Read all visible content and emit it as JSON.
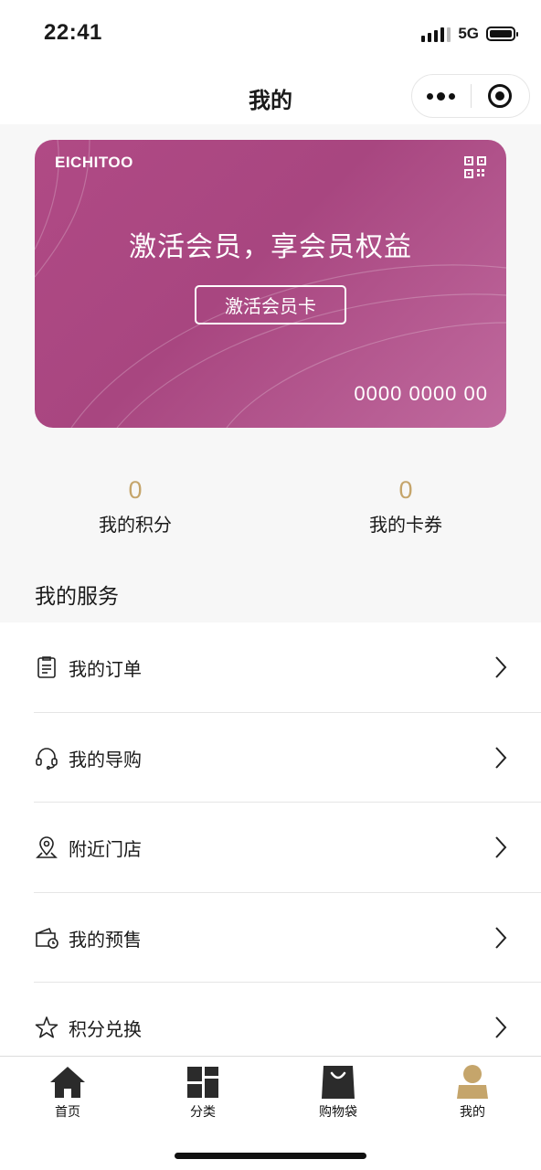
{
  "status_bar": {
    "time": "22:41",
    "network": "5G"
  },
  "nav": {
    "title": "我的"
  },
  "card": {
    "brand": "EICHITOO",
    "headline": "激活会员，享会员权益",
    "activate_label": "激活会员卡",
    "number": "0000 0000 00",
    "colors": {
      "primary": "#a84680",
      "highlight": "#c06a9e"
    }
  },
  "stats": [
    {
      "value": "0",
      "label": "我的积分"
    },
    {
      "value": "0",
      "label": "我的卡券"
    }
  ],
  "services": {
    "title": "我的服务",
    "items": [
      {
        "label": "我的订单",
        "icon": "order-list-icon"
      },
      {
        "label": "我的导购",
        "icon": "headset-icon"
      },
      {
        "label": "附近门店",
        "icon": "location-pin-icon"
      },
      {
        "label": "我的预售",
        "icon": "wallet-clock-icon"
      },
      {
        "label": "积分兑换",
        "icon": "star-icon"
      }
    ]
  },
  "tab_bar": {
    "active_color": "#c5a56b",
    "tabs": [
      {
        "label": "首页",
        "icon": "home-icon",
        "active": false
      },
      {
        "label": "分类",
        "icon": "category-grid-icon",
        "active": false
      },
      {
        "label": "购物袋",
        "icon": "shopping-bag-icon",
        "active": false
      },
      {
        "label": "我的",
        "icon": "profile-icon",
        "active": true
      }
    ]
  }
}
